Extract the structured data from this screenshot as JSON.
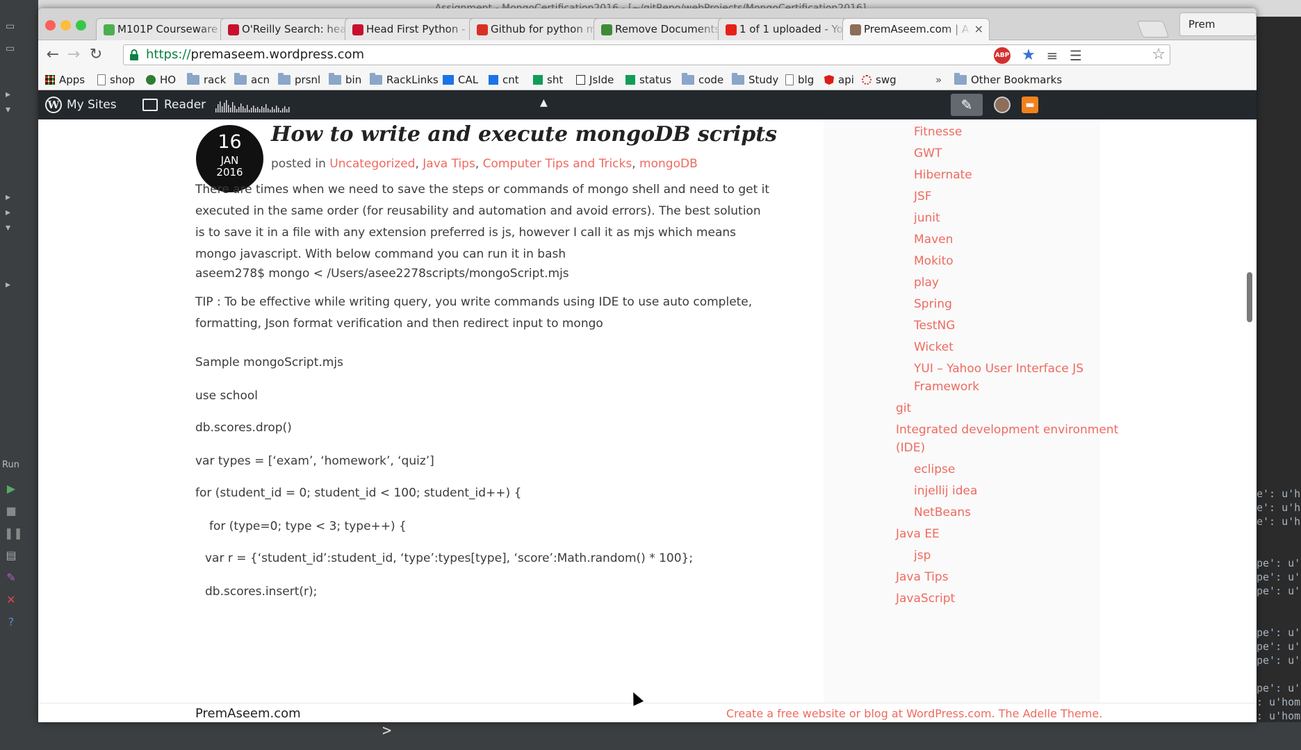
{
  "ide": {
    "title": "Assignment - MongoCertification2016 - [~/gitRepo/webProjects/MongoCertification2016]",
    "run_label": "Run",
    "console_lines": [
      "e': u'h",
      "e': u'h",
      "e': u'h",
      "pe': u'h",
      "pe': u'",
      "pe': u'",
      "pe': u'",
      "pe': u'",
      "pe': u'",
      "pe': u'",
      ": u'hom",
      ": u'hom"
    ],
    "console_prompt": ">"
  },
  "browser": {
    "tabs": [
      {
        "label": "M101P Courseware",
        "favicon": "mongodb-leaf-icon",
        "color": "#4caf50"
      },
      {
        "label": "O'Reilly Search: hea",
        "favicon": "oreilly-icon",
        "color": "#c8102e"
      },
      {
        "label": "Head First Python -",
        "favicon": "oreilly-icon",
        "color": "#c8102e"
      },
      {
        "label": "Github for python m",
        "favicon": "gmail-icon",
        "color": "#d93025"
      },
      {
        "label": "Remove Documents",
        "favicon": "mongodb-leaf-icon",
        "color": "#3d8b37"
      },
      {
        "label": "1 of 1 uploaded - Yo",
        "favicon": "youtube-icon",
        "color": "#e62117"
      },
      {
        "label": "PremAseem.com | A",
        "favicon": "avatar-icon",
        "color": "#8d6e5a"
      }
    ],
    "profile_name": "Prem Aseem",
    "url_scheme": "https://",
    "url_rest": "premaseem.wordpress.com",
    "extensions": [
      {
        "name": "adblock-plus-icon",
        "label": "ABP",
        "color": "#d32f2f"
      },
      {
        "name": "bookmark-star-icon",
        "label": "★",
        "color": "#3a6fd8"
      },
      {
        "name": "stack-icon",
        "label": "≡",
        "color": "#555555"
      },
      {
        "name": "menu-icon",
        "label": "☰",
        "color": "#555555"
      }
    ],
    "bookmarks": [
      {
        "label": "Apps",
        "icon": "apps-grid-icon"
      },
      {
        "label": "shop",
        "icon": "page-icon"
      },
      {
        "label": "HO",
        "icon": "whatsapp-icon"
      },
      {
        "label": "rack",
        "icon": "folder-icon"
      },
      {
        "label": "acn",
        "icon": "folder-icon"
      },
      {
        "label": "prsnl",
        "icon": "folder-icon"
      },
      {
        "label": "bin",
        "icon": "folder-icon"
      },
      {
        "label": "RackLinks",
        "icon": "folder-icon"
      },
      {
        "label": "CAL",
        "icon": "calendar-icon"
      },
      {
        "label": "cnt",
        "icon": "contacts-icon"
      },
      {
        "label": "sht",
        "icon": "sheets-icon"
      },
      {
        "label": "JsIde",
        "icon": "download-icon"
      },
      {
        "label": "status",
        "icon": "sheets-icon"
      },
      {
        "label": "code",
        "icon": "folder-icon"
      },
      {
        "label": "Study",
        "icon": "folder-icon"
      },
      {
        "label": "blg",
        "icon": "page-icon"
      },
      {
        "label": "api",
        "icon": "angular-icon"
      },
      {
        "label": "swg",
        "icon": "spinner-icon"
      }
    ],
    "bookmarks_overflow": "»",
    "other_bookmarks": "Other Bookmarks"
  },
  "adminbar": {
    "my_sites": "My Sites",
    "reader": "Reader",
    "collapse": "▲"
  },
  "post": {
    "day": "16",
    "month": "JAN",
    "year": "2016",
    "title": "How to write and execute mongoDB scripts",
    "posted_in": "posted in",
    "categories": [
      "Uncategorized",
      "Java Tips",
      "Computer Tips and Tricks",
      "mongoDB"
    ],
    "para1": "There are times when we need to save the steps or commands of mongo shell and need to get it executed in the same order (for reusability and automation and avoid errors). The best solution is to save it in a file with any extension preferred is js, however I call it as mjs which means mongo javascript. With below command you can run it in bash",
    "command": "aseem278$ mongo < /Users/asee2278scripts/mongoScript.mjs",
    "tip": "TIP : To be effective while writing query, you write commands using IDE to use auto complete, formatting, Json format verification and then redirect input to mongo",
    "sample_heading": "Sample mongoScript.mjs",
    "code": [
      "use school",
      "db.scores.drop()",
      "var types = [‘exam’, ‘homework’, ‘quiz’]",
      "for (student_id = 0; student_id < 100; student_id++) {",
      "for (type=0; type < 3; type++) {",
      "var r = {‘student_id’:student_id, ‘type’:types[type], ‘score’:Math.random() * 100};",
      "db.scores.insert(r);"
    ]
  },
  "sidebar": {
    "items": [
      {
        "label": "Fitnesse",
        "level": 2
      },
      {
        "label": "GWT",
        "level": 2
      },
      {
        "label": "Hibernate",
        "level": 2
      },
      {
        "label": "JSF",
        "level": 2
      },
      {
        "label": "junit",
        "level": 2
      },
      {
        "label": "Maven",
        "level": 2
      },
      {
        "label": "Mokito",
        "level": 2
      },
      {
        "label": "play",
        "level": 2
      },
      {
        "label": "Spring",
        "level": 2
      },
      {
        "label": "TestNG",
        "level": 2
      },
      {
        "label": "Wicket",
        "level": 2
      },
      {
        "label": "YUI – Yahoo User Interface JS",
        "level": 2
      },
      {
        "label": "Framework",
        "level": 2
      },
      {
        "label": "git",
        "level": 1
      },
      {
        "label": "Integrated development environment",
        "level": 1
      },
      {
        "label": "(IDE)",
        "level": 1
      },
      {
        "label": "eclipse",
        "level": 2
      },
      {
        "label": "injellij idea",
        "level": 2
      },
      {
        "label": "NetBeans",
        "level": 2
      },
      {
        "label": "Java EE",
        "level": 1
      },
      {
        "label": "jsp",
        "level": 2
      },
      {
        "label": "Java Tips",
        "level": 1
      },
      {
        "label": "JavaScript",
        "level": 1
      }
    ]
  },
  "footer": {
    "site": "PremAseem.com",
    "credit": "Create a free website or blog at WordPress.com. The Adelle Theme."
  },
  "colors": {
    "accent": "#ef6a5f",
    "adminbar": "#23282d"
  }
}
